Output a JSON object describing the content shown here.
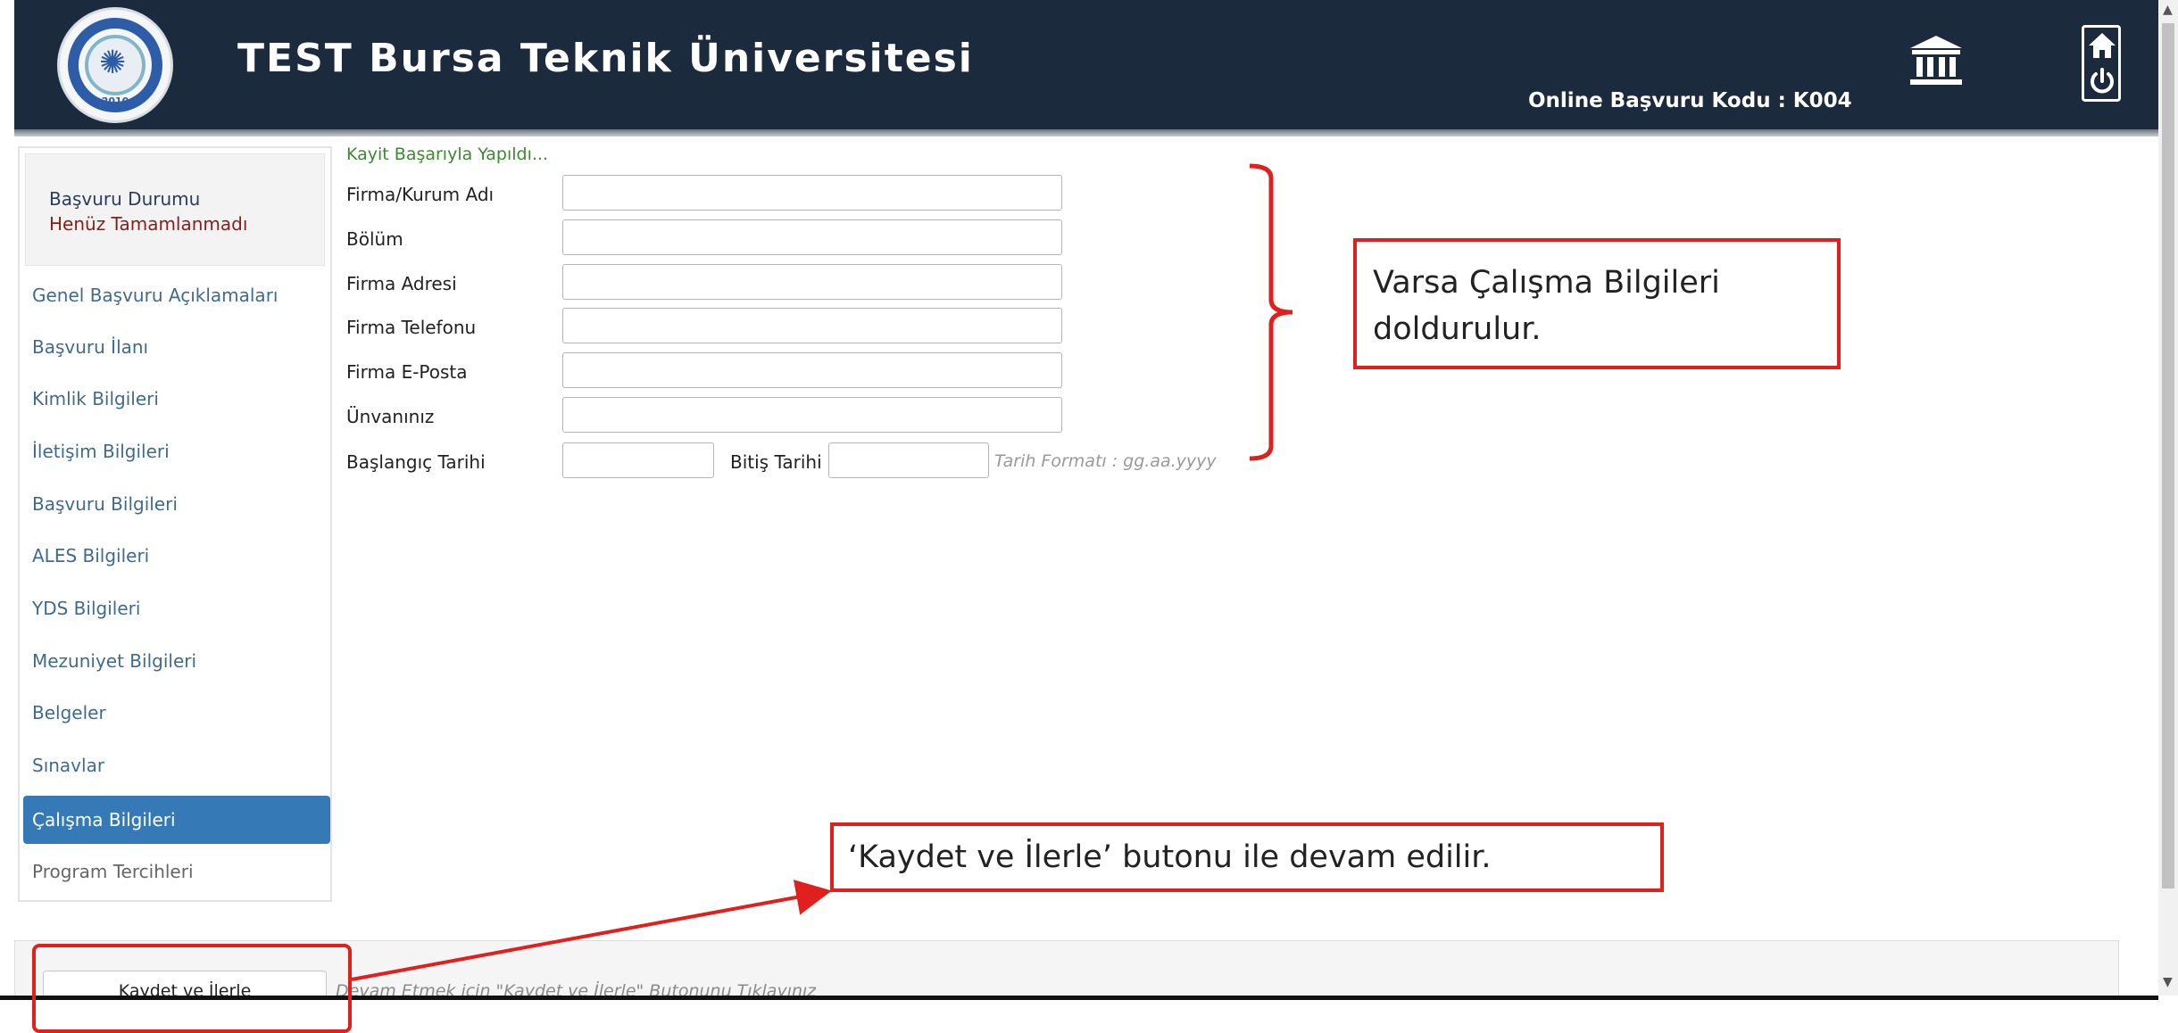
{
  "header": {
    "logo_year": "2010",
    "title": "TEST Bursa Teknik Üniversitesi",
    "application_code": "Online Başvuru Kodu : K004",
    "icons": [
      "university-icon",
      "home-icon",
      "power-icon"
    ]
  },
  "sidebar": {
    "status": {
      "title": "Başvuru Durumu",
      "value": "Henüz Tamamlanmadı"
    },
    "items": [
      {
        "label": "Genel Başvuru Açıklamaları"
      },
      {
        "label": "Başvuru İlanı"
      },
      {
        "label": "Kimlik Bilgileri"
      },
      {
        "label": "İletişim Bilgileri"
      },
      {
        "label": "Başvuru Bilgileri"
      },
      {
        "label": "ALES Bilgileri"
      },
      {
        "label": "YDS Bilgileri"
      },
      {
        "label": "Mezuniyet Bilgileri"
      },
      {
        "label": "Belgeler"
      },
      {
        "label": "Sınavlar"
      },
      {
        "label": "Çalışma Bilgileri"
      },
      {
        "label": "Program Tercihleri"
      }
    ],
    "active_item": "Çalışma Bilgileri"
  },
  "form": {
    "success_message": "Kayit Başarıyla Yapıldı...",
    "fields": {
      "company_name": {
        "label": "Firma/Kurum Adı",
        "value": ""
      },
      "department": {
        "label": "Bölüm",
        "value": ""
      },
      "company_address": {
        "label": "Firma Adresi",
        "value": ""
      },
      "company_phone": {
        "label": "Firma Telefonu",
        "value": ""
      },
      "company_email": {
        "label": "Firma E-Posta",
        "value": ""
      },
      "job_title": {
        "label": "Ünvanınız",
        "value": ""
      },
      "start_date": {
        "label": "Başlangıç Tarihi",
        "value": ""
      },
      "end_date": {
        "label": "Bitiş Tarihi",
        "value": ""
      }
    },
    "date_format_hint": "Tarih Formatı : gg.aa.yyyy"
  },
  "annotations": {
    "work_info_note": "Varsa Çalışma  Bilgileri doldurulur.",
    "save_note": "‘Kaydet ve İlerle’ butonu ile devam edilir.",
    "color": "#e0201c"
  },
  "footer": {
    "save_button_label": "Kaydet ve İlerle",
    "hint": "Devam Etmek için \"Kaydet ve İlerle\" Butonunu Tıklayınız"
  },
  "colors": {
    "header_bg": "#1b2a3c",
    "active_item_bg": "#357ab7",
    "success": "#3a8a2e",
    "status_value": "#8a1c1c"
  }
}
